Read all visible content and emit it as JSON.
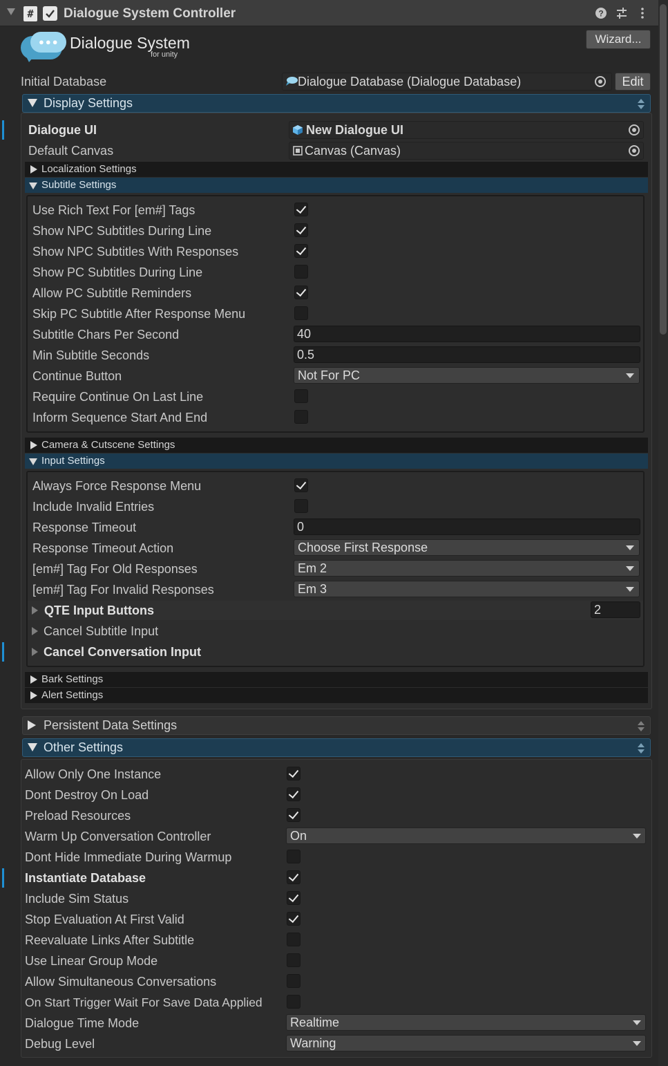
{
  "header": {
    "title": "Dialogue System Controller",
    "script_icon": "#",
    "help_icon": "question-icon",
    "presets_icon": "sliders-icon",
    "menu_icon": "kebab-menu-icon"
  },
  "logo": {
    "title": "Dialogue System",
    "subtitle": "for unity"
  },
  "wizard_label": "Wizard...",
  "initial_database": {
    "label": "Initial Database",
    "value": "Dialogue Database (Dialogue Database)",
    "edit_label": "Edit"
  },
  "display_settings": {
    "title": "Display Settings",
    "dialogue_ui": {
      "label": "Dialogue UI",
      "value": "New Dialogue UI"
    },
    "default_canvas": {
      "label": "Default Canvas",
      "value": "Canvas (Canvas)"
    },
    "localization_title": "Localization Settings",
    "subtitle_title": "Subtitle Settings",
    "subtitle": {
      "rich_text": {
        "label": "Use Rich Text For [em#] Tags",
        "checked": true
      },
      "npc_during": {
        "label": "Show NPC Subtitles During Line",
        "checked": true
      },
      "npc_with_responses": {
        "label": "Show NPC Subtitles With Responses",
        "checked": true
      },
      "pc_during": {
        "label": "Show PC Subtitles During Line",
        "checked": false
      },
      "pc_reminders": {
        "label": "Allow PC Subtitle Reminders",
        "checked": true
      },
      "skip_pc": {
        "label": "Skip PC Subtitle After Response Menu",
        "checked": false
      },
      "chars_per_second": {
        "label": "Subtitle Chars Per Second",
        "value": "40"
      },
      "min_seconds": {
        "label": "Min Subtitle Seconds",
        "value": "0.5"
      },
      "continue_button": {
        "label": "Continue Button",
        "value": "Not For PC"
      },
      "require_continue": {
        "label": "Require Continue On Last Line",
        "checked": false
      },
      "inform_sequence": {
        "label": "Inform Sequence Start And End",
        "checked": false
      }
    },
    "camera_title": "Camera & Cutscene Settings",
    "input_title": "Input Settings",
    "input": {
      "force_menu": {
        "label": "Always Force Response Menu",
        "checked": true
      },
      "invalid_entries": {
        "label": "Include Invalid Entries",
        "checked": false
      },
      "timeout": {
        "label": "Response Timeout",
        "value": "0"
      },
      "timeout_action": {
        "label": "Response Timeout Action",
        "value": "Choose First Response"
      },
      "old_tag": {
        "label": "[em#] Tag For Old Responses",
        "value": "Em 2"
      },
      "invalid_tag": {
        "label": "[em#] Tag For Invalid Responses",
        "value": "Em 3"
      },
      "qte": {
        "label": "QTE Input Buttons",
        "count": "2"
      },
      "cancel_subtitle": {
        "label": "Cancel Subtitle Input"
      },
      "cancel_conversation": {
        "label": "Cancel Conversation Input"
      }
    },
    "bark_title": "Bark Settings",
    "alert_title": "Alert Settings"
  },
  "persistent_title": "Persistent Data Settings",
  "other_settings": {
    "title": "Other Settings",
    "one_instance": {
      "label": "Allow Only One Instance",
      "checked": true
    },
    "dont_destroy": {
      "label": "Dont Destroy On Load",
      "checked": true
    },
    "preload": {
      "label": "Preload Resources",
      "checked": true
    },
    "warm_up": {
      "label": "Warm Up Conversation Controller",
      "value": "On"
    },
    "dont_hide": {
      "label": "Dont Hide Immediate During Warmup",
      "checked": false
    },
    "instantiate_db": {
      "label": "Instantiate Database",
      "checked": true
    },
    "sim_status": {
      "label": "Include Sim Status",
      "checked": true
    },
    "stop_eval": {
      "label": "Stop Evaluation At First Valid",
      "checked": true
    },
    "reevaluate": {
      "label": "Reevaluate Links After Subtitle",
      "checked": false
    },
    "linear_group": {
      "label": "Use Linear Group Mode",
      "checked": false
    },
    "simultaneous": {
      "label": "Allow Simultaneous Conversations",
      "checked": false
    },
    "wait_save": {
      "label": "On Start Trigger Wait For Save Data Applied",
      "checked": false
    },
    "time_mode": {
      "label": "Dialogue Time Mode",
      "value": "Realtime"
    },
    "debug_level": {
      "label": "Debug Level",
      "value": "Warning"
    }
  },
  "colors": {
    "accent": "#1e8fd4",
    "section_header": "#1d3d52",
    "background": "#282828"
  }
}
